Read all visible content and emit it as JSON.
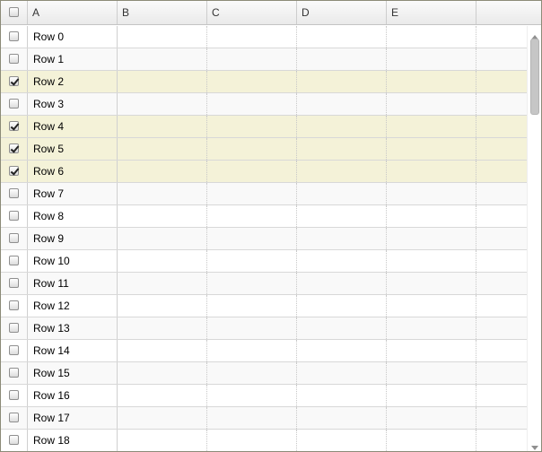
{
  "columns": [
    {
      "key": "check",
      "label": ""
    },
    {
      "key": "A",
      "label": "A"
    },
    {
      "key": "B",
      "label": "B"
    },
    {
      "key": "C",
      "label": "C"
    },
    {
      "key": "D",
      "label": "D"
    },
    {
      "key": "E",
      "label": "E"
    }
  ],
  "header_checkbox_checked": false,
  "rows": [
    {
      "label": "Row 0",
      "checked": false
    },
    {
      "label": "Row 1",
      "checked": false
    },
    {
      "label": "Row 2",
      "checked": true
    },
    {
      "label": "Row 3",
      "checked": false
    },
    {
      "label": "Row 4",
      "checked": true
    },
    {
      "label": "Row 5",
      "checked": true
    },
    {
      "label": "Row 6",
      "checked": true
    },
    {
      "label": "Row 7",
      "checked": false
    },
    {
      "label": "Row 8",
      "checked": false
    },
    {
      "label": "Row 9",
      "checked": false
    },
    {
      "label": "Row 10",
      "checked": false
    },
    {
      "label": "Row 11",
      "checked": false
    },
    {
      "label": "Row 12",
      "checked": false
    },
    {
      "label": "Row 13",
      "checked": false
    },
    {
      "label": "Row 14",
      "checked": false
    },
    {
      "label": "Row 15",
      "checked": false
    },
    {
      "label": "Row 16",
      "checked": false
    },
    {
      "label": "Row 17",
      "checked": false
    },
    {
      "label": "Row 18",
      "checked": false
    }
  ],
  "colors": {
    "selected_row": "#f4f2d8",
    "alt_row": "#f9f9f9",
    "border": "#8c8b78"
  },
  "icons": {
    "scroll_up": "triangle-up-icon",
    "scroll_down": "triangle-down-icon"
  }
}
